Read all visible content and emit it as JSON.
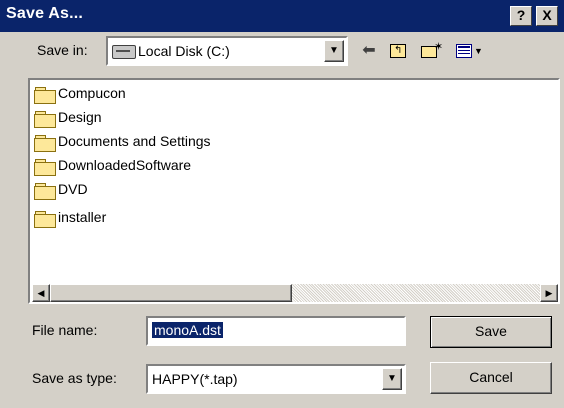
{
  "window": {
    "title": "Save As...",
    "help_button": "?",
    "close_button": "X"
  },
  "lookin": {
    "label": "Save in:",
    "value": "Local Disk (C:)"
  },
  "toolbar": {
    "icons": [
      "back-arrow-icon",
      "up-one-level-icon",
      "new-folder-icon",
      "view-menu-icon"
    ]
  },
  "files": [
    {
      "name": "Compucon",
      "type": "folder"
    },
    {
      "name": "Design",
      "type": "folder"
    },
    {
      "name": "Documents and Settings",
      "type": "folder"
    },
    {
      "name": "DownloadedSoftware",
      "type": "folder"
    },
    {
      "name": "DVD",
      "type": "folder"
    },
    {
      "name": "installer",
      "type": "folder"
    }
  ],
  "filename": {
    "label": "File name:",
    "value": "monoA.dst"
  },
  "filetype": {
    "label": "Save as type:",
    "value": "HAPPY(*.tap)"
  },
  "buttons": {
    "save": "Save",
    "cancel": "Cancel"
  },
  "colors": {
    "titlebar": "#0a246a",
    "face": "#d4d0c8",
    "selection": "#0a246a",
    "folder": "#fde89a"
  }
}
